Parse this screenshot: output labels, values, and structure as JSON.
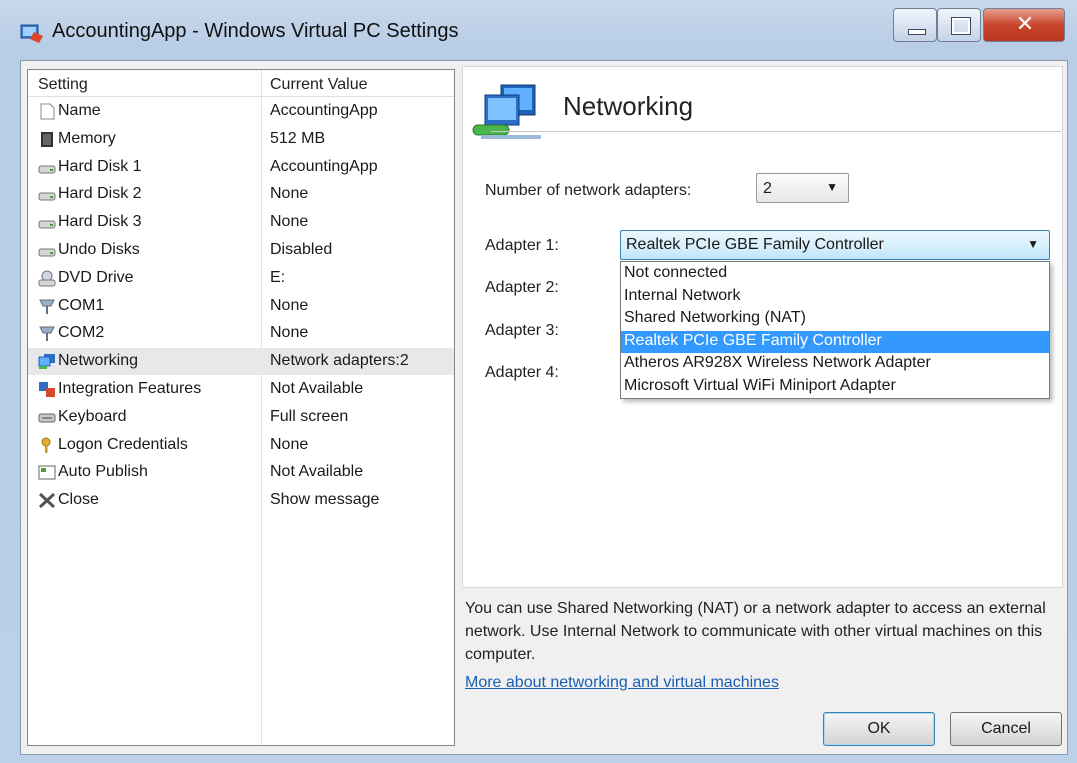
{
  "window": {
    "title": "AccountingApp - Windows Virtual PC Settings",
    "close_glyph": "✕"
  },
  "settings_list": {
    "headers": {
      "setting": "Setting",
      "current_value": "Current Value"
    },
    "rows": [
      {
        "name": "Name",
        "value": "AccountingApp",
        "icon": "document-icon"
      },
      {
        "name": "Memory",
        "value": "512 MB",
        "icon": "memory-chip-icon"
      },
      {
        "name": "Hard Disk 1",
        "value": "AccountingApp",
        "icon": "hard-disk-icon"
      },
      {
        "name": "Hard Disk 2",
        "value": "None",
        "icon": "hard-disk-icon"
      },
      {
        "name": "Hard Disk 3",
        "value": "None",
        "icon": "hard-disk-icon"
      },
      {
        "name": "Undo Disks",
        "value": "Disabled",
        "icon": "hard-disk-icon"
      },
      {
        "name": "DVD Drive",
        "value": "E:",
        "icon": "dvd-drive-icon"
      },
      {
        "name": "COM1",
        "value": "None",
        "icon": "serial-port-icon"
      },
      {
        "name": "COM2",
        "value": "None",
        "icon": "serial-port-icon"
      },
      {
        "name": "Networking",
        "value": "Network adapters:2",
        "icon": "networking-icon",
        "selected": true
      },
      {
        "name": "Integration Features",
        "value": "Not Available",
        "icon": "integration-icon"
      },
      {
        "name": "Keyboard",
        "value": "Full screen",
        "icon": "keyboard-icon"
      },
      {
        "name": "Logon Credentials",
        "value": "None",
        "icon": "key-icon"
      },
      {
        "name": "Auto Publish",
        "value": "Not Available",
        "icon": "auto-publish-icon"
      },
      {
        "name": "Close",
        "value": "Show message",
        "icon": "close-x-icon"
      }
    ]
  },
  "networking": {
    "title": "Networking",
    "num_adapters_label": "Number of network adapters:",
    "num_adapters_value": "2",
    "adapter_labels": [
      "Adapter 1:",
      "Adapter 2:",
      "Adapter 3:",
      "Adapter 4:"
    ],
    "adapter1_value": "Realtek PCIe GBE Family Controller",
    "dropdown_options": [
      "Not connected",
      "Internal Network",
      "Shared Networking (NAT)",
      "Realtek PCIe GBE Family Controller",
      "Atheros AR928X Wireless Network Adapter",
      "Microsoft Virtual WiFi Miniport Adapter"
    ],
    "dropdown_selected_index": 3
  },
  "description": "You can use Shared Networking (NAT) or a network adapter to access an external network. Use Internal Network to communicate with other virtual machines on this computer.",
  "more_link": "More about networking and virtual machines",
  "buttons": {
    "ok": "OK",
    "cancel": "Cancel"
  },
  "colors": {
    "selection": "#3399ff",
    "link": "#1b5fb5",
    "close_button": "#c8452c"
  }
}
